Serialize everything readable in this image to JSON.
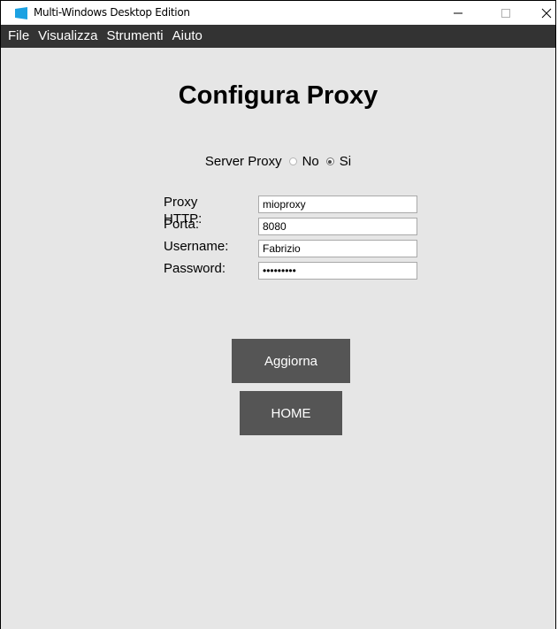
{
  "window": {
    "title": "Multi-Windows Desktop Edition",
    "icon": "windows-logo-icon",
    "controls": [
      "minimize-icon",
      "maximize-icon",
      "close-icon"
    ]
  },
  "menu": {
    "items": [
      {
        "label": "File"
      },
      {
        "label": "Visualizza"
      },
      {
        "label": "Strumenti"
      },
      {
        "label": "Aiuto"
      }
    ]
  },
  "page": {
    "title": "Configura Proxy"
  },
  "proxy_server": {
    "label": "Server Proxy",
    "options": [
      {
        "label": "No",
        "checked": false
      },
      {
        "label": "Si",
        "checked": true
      }
    ]
  },
  "form": {
    "fields": [
      {
        "label": "Proxy HTTP:",
        "value": "mioproxy",
        "type": "text"
      },
      {
        "label": "Porta:",
        "value": "8080",
        "type": "text"
      },
      {
        "label": "Username:",
        "value": "Fabrizio",
        "type": "text"
      },
      {
        "label": "Password:",
        "value": "•••••••••",
        "type": "password"
      }
    ]
  },
  "buttons": {
    "update_label": "Aggiorna",
    "home_label": "HOME"
  },
  "colors": {
    "menubar": "#333333",
    "background": "#e6e6e6",
    "button": "#555555",
    "app_icon": "#1ba1e2"
  }
}
